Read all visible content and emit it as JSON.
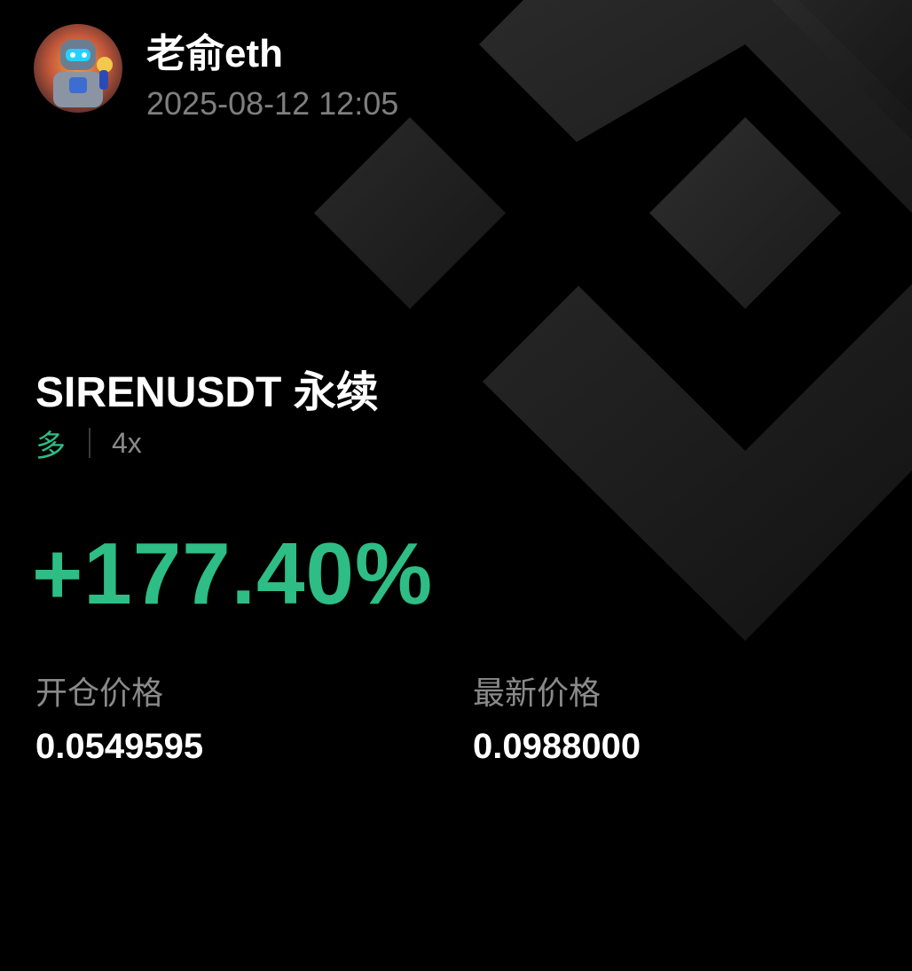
{
  "user": {
    "name": "老俞eth",
    "avatar_icon": "robot-avatar-icon"
  },
  "post": {
    "timestamp": "2025-08-12 12:05"
  },
  "position": {
    "symbol": "SIRENUSDT 永续",
    "side": "多",
    "leverage": "4x",
    "pnl_percent": "+177.40%",
    "entry_price_label": "开仓价格",
    "entry_price": "0.0549595",
    "mark_price_label": "最新价格",
    "mark_price": "0.0988000"
  },
  "colors": {
    "background": "#000000",
    "profit_green": "#2ebd85",
    "muted_gray": "#8a8a8a",
    "text_white": "#ffffff"
  },
  "background_icon": "binance-logo-watermark-icon"
}
